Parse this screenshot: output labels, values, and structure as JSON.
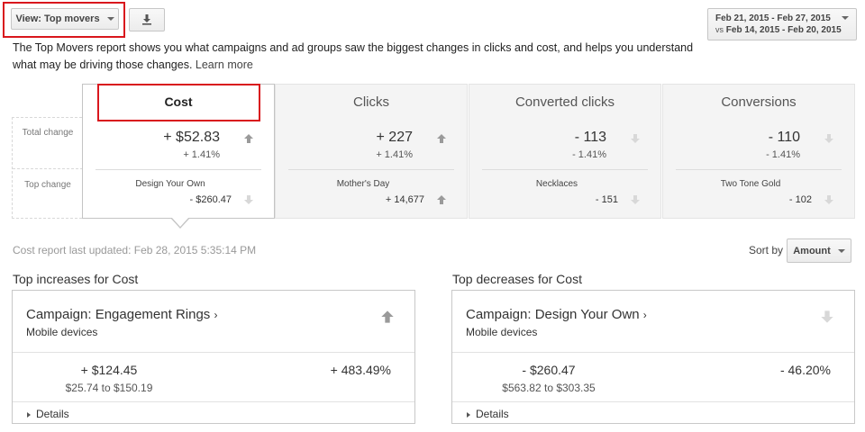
{
  "toolbar": {
    "view_label": "View: Top movers",
    "date_range": "Feb 21, 2015 - Feb 27, 2015",
    "compare_prefix": "vs",
    "compare_range": "Feb 14, 2015 - Feb 20, 2015"
  },
  "intro": {
    "text": "The Top Movers report shows you what campaigns and ad groups saw the biggest changes in clicks and cost, and helps you understand what may be driving those changes.",
    "link": "Learn more"
  },
  "row_labels": {
    "total": "Total change",
    "top": "Top change"
  },
  "tabs": [
    {
      "title": "Cost",
      "total": "+ $52.83",
      "total_pct": "+ 1.41%",
      "top_name": "Design Your Own",
      "top_value": "- $260.47",
      "total_dir": "up",
      "top_dir": "down"
    },
    {
      "title": "Clicks",
      "total": "+ 227",
      "total_pct": "+ 1.41%",
      "top_name": "Mother's Day",
      "top_value": "+ 14,677",
      "total_dir": "up",
      "top_dir": "up"
    },
    {
      "title": "Converted clicks",
      "total": "- 113",
      "total_pct": "- 1.41%",
      "top_name": "Necklaces",
      "top_value": "- 151",
      "total_dir": "down",
      "top_dir": "down"
    },
    {
      "title": "Conversions",
      "total": "- 110",
      "total_pct": "- 1.41%",
      "top_name": "Two Tone Gold",
      "top_value": "- 102",
      "total_dir": "down",
      "top_dir": "down"
    }
  ],
  "report": {
    "updated": "Cost report last updated: Feb 28, 2015 5:35:14 PM",
    "sort_label": "Sort by",
    "sort_value": "Amount"
  },
  "increases": {
    "title": "Top increases for Cost",
    "campaign": "Campaign: Engagement Rings",
    "device": "Mobile devices",
    "amount": "+ $124.45",
    "range": "$25.74 to $150.19",
    "pct": "+ 483.49%",
    "details": "Details"
  },
  "decreases": {
    "title": "Top decreases for Cost",
    "campaign": "Campaign: Design Your Own",
    "device": "Mobile devices",
    "amount": "- $260.47",
    "range": "$563.82 to $303.35",
    "pct": "- 46.20%",
    "details": "Details"
  },
  "colors": {
    "highlight": "#d9171d",
    "arrow_up": "#9a9a9a",
    "arrow_down": "#d8d8d8"
  }
}
